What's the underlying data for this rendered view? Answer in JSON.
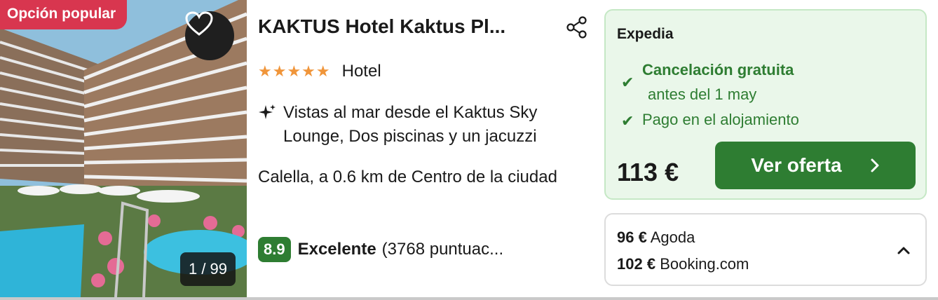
{
  "photo": {
    "badge": "Opción popular",
    "counter": "1 / 99",
    "favorite_icon": "heart-icon"
  },
  "hotel": {
    "name": "KAKTUS Hotel Kaktus Pl...",
    "share_icon": "share-icon",
    "stars": "★★★★★",
    "star_count": 5,
    "type": "Hotel",
    "highlights": "Vistas al mar desde el Kaktus Sky Lounge, Dos piscinas y un jacuzzi",
    "highlights_icon": "sparkle-icon",
    "location": "Calella, a 0.6 km de Centro de la ciudad",
    "score": "8.9",
    "rating_label": "Excelente",
    "reviews": "(3768 puntuac..."
  },
  "deal": {
    "provider": "Expedia",
    "free_cancellation": "Cancelación gratuita",
    "cancel_before": "antes del 1 may",
    "pay_at_hotel": "Pago en el alojamiento",
    "price": "113 €",
    "cta": "Ver oferta"
  },
  "other_offers": [
    {
      "price": "96 €",
      "provider": "Agoda"
    },
    {
      "price": "102 €",
      "provider": "Booking.com"
    }
  ],
  "colors": {
    "accent_green": "#2e7d32",
    "badge_red": "#d8364f",
    "star_orange": "#f0953a",
    "deal_bg": "#eaf7ea"
  }
}
